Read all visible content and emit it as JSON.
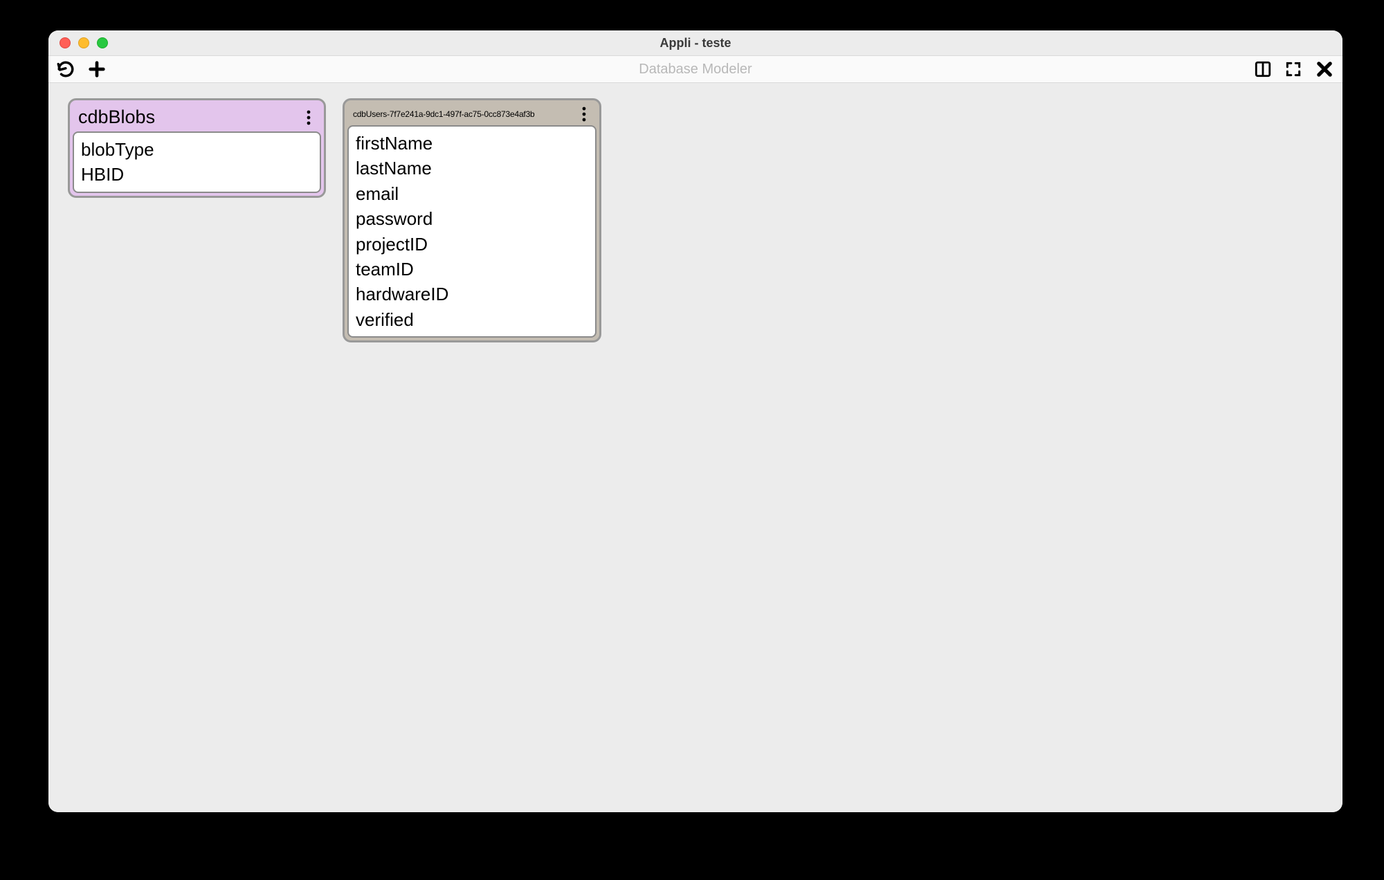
{
  "window": {
    "title": "Appli - teste"
  },
  "toolbar": {
    "center_label": "Database Modeler"
  },
  "entities": [
    {
      "title": "cdbBlobs",
      "header_color": "#e3c5ec",
      "fields": [
        "blobType",
        "HBID"
      ]
    },
    {
      "title": "cdbUsers-7f7e241a-9dc1-497f-ac75-0cc873e4af3b",
      "header_color": "#c4bdb2",
      "fields": [
        "firstName",
        "lastName",
        "email",
        "password",
        "projectID",
        "teamID",
        "hardwareID",
        "verified"
      ]
    }
  ]
}
